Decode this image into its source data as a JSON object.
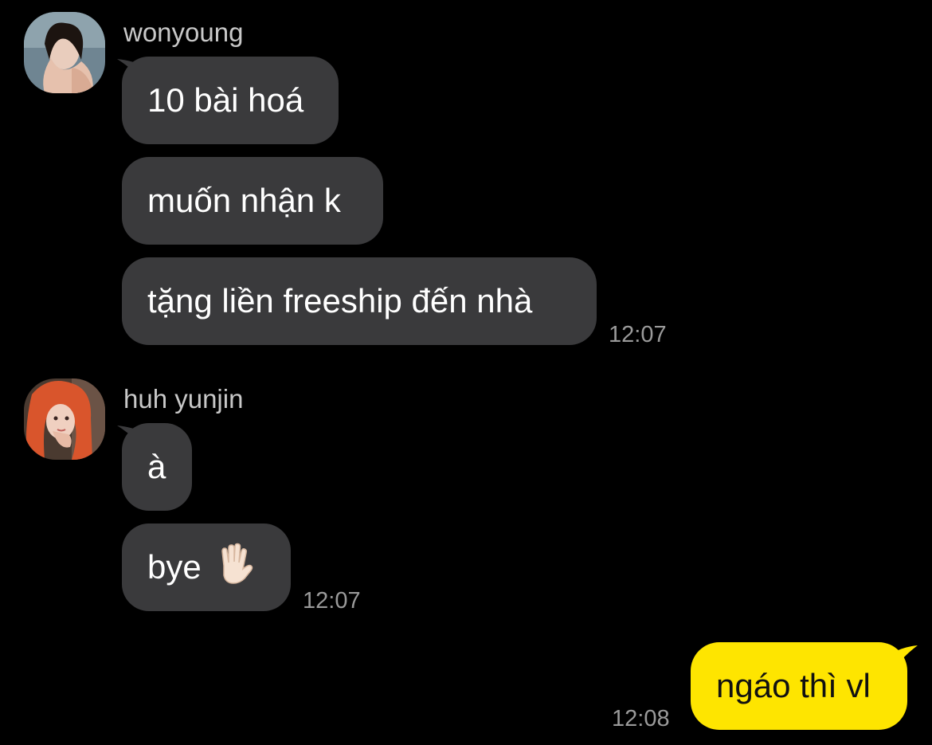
{
  "chat": {
    "groups": [
      {
        "sender": "wonyoung",
        "messages": [
          "10 bài hoá",
          "muốn nhận k",
          "tặng liền freeship đến nhà"
        ],
        "time": "12:07"
      },
      {
        "sender": "huh yunjin",
        "messages": [
          "à",
          "bye"
        ],
        "time": "12:07"
      }
    ],
    "mine": {
      "message": "ngáo thì vl",
      "time": "12:08"
    }
  },
  "colors": {
    "background": "#000000",
    "incoming_bubble": "#3a3a3c",
    "outgoing_bubble": "#fee500",
    "sender_name": "#c8c8c8",
    "timestamp": "#9a9a9a"
  },
  "icons": {
    "wave": "raised-hand-emoji"
  }
}
